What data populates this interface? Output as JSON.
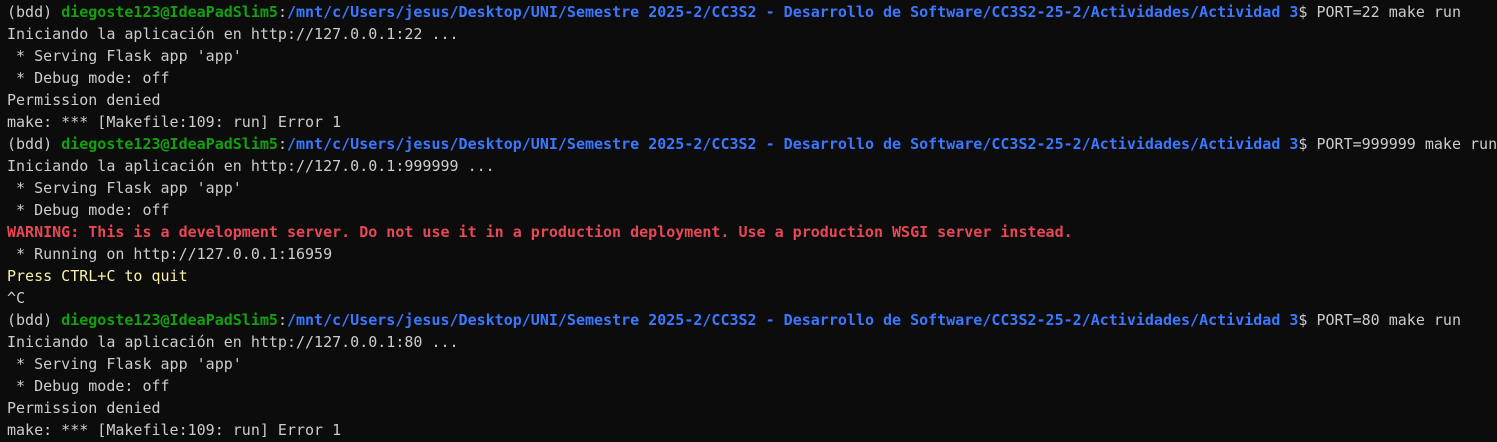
{
  "colors": {
    "background": "#0c0c0c",
    "text": "#cccccc",
    "userhost": "#13a10e",
    "path": "#3b78ff",
    "warning": "#e74856",
    "yellow": "#f9f1a5"
  },
  "prompt": {
    "env": "(bdd) ",
    "userhost": "diegoste123@IdeaPadSlim5",
    "colon": ":",
    "path": "/mnt/c/Users/jesus/Desktop/UNI/Semestre 2025-2/CC3S2 - Desarrollo de Software/CC3S2-25-2/Actividades/Actividad 3",
    "dollar": "$ "
  },
  "lines": [
    {
      "type": "prompt",
      "command": "PORT=22 make run"
    },
    {
      "type": "out",
      "text": "Iniciando la aplicación en http://127.0.0.1:22 ..."
    },
    {
      "type": "out",
      "text": " * Serving Flask app 'app'"
    },
    {
      "type": "out",
      "text": " * Debug mode: off"
    },
    {
      "type": "out",
      "text": "Permission denied"
    },
    {
      "type": "out",
      "text": "make: *** [Makefile:109: run] Error 1"
    },
    {
      "type": "prompt",
      "command": "PORT=999999 make run"
    },
    {
      "type": "out",
      "text": "Iniciando la aplicación en http://127.0.0.1:999999 ..."
    },
    {
      "type": "out",
      "text": " * Serving Flask app 'app'"
    },
    {
      "type": "out",
      "text": " * Debug mode: off"
    },
    {
      "type": "warning",
      "text": "WARNING: This is a development server. Do not use it in a production deployment. Use a production WSGI server instead."
    },
    {
      "type": "out",
      "text": " * Running on http://127.0.0.1:16959"
    },
    {
      "type": "yellow",
      "text": "Press CTRL+C to quit"
    },
    {
      "type": "out",
      "text": "^C"
    },
    {
      "type": "prompt",
      "command": "PORT=80 make run"
    },
    {
      "type": "out",
      "text": "Iniciando la aplicación en http://127.0.0.1:80 ..."
    },
    {
      "type": "out",
      "text": " * Serving Flask app 'app'"
    },
    {
      "type": "out",
      "text": " * Debug mode: off"
    },
    {
      "type": "out",
      "text": "Permission denied"
    },
    {
      "type": "out",
      "text": "make: *** [Makefile:109: run] Error 1"
    }
  ]
}
